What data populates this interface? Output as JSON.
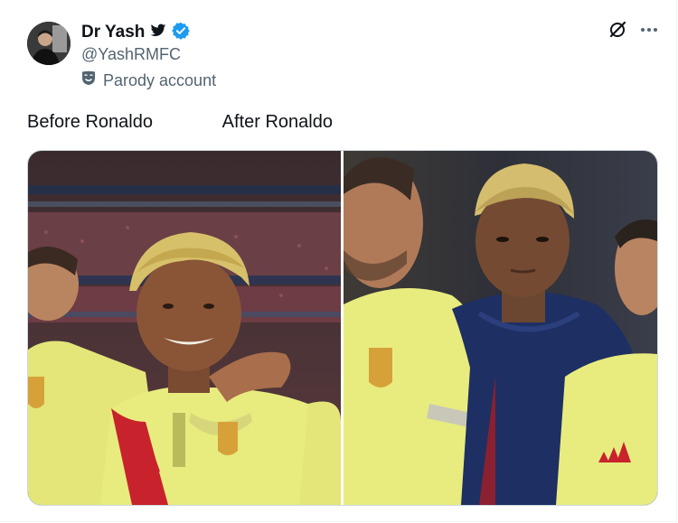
{
  "author": {
    "display_name": "Dr Yash",
    "handle": "@YashRMFC",
    "label": "Parody account"
  },
  "tweet": {
    "text": "Before Ronaldo              After Ronaldo"
  },
  "icons": {
    "verified": "verified-badge-icon",
    "bird": "twitter-bird-icon",
    "grok": "grok-icon",
    "more": "more-options-icon",
    "parody": "parody-mask-icon"
  },
  "colors": {
    "verified_blue": "#1d9bf0",
    "text_primary": "#0f1419",
    "text_secondary": "#536471",
    "jersey_yellow": "#e8ec7f",
    "jacket_navy": "#1e2f63",
    "collar_red": "#c8232c"
  }
}
